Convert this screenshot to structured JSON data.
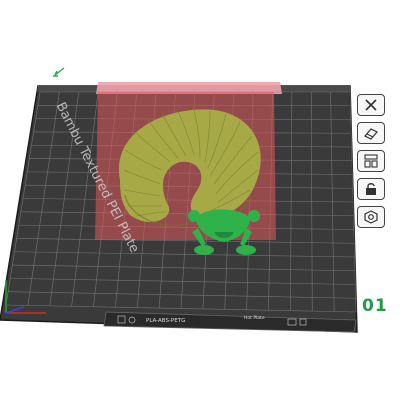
{
  "bed": {
    "label": "Bambu Textured PEI Plate",
    "plate_number": "01",
    "filament_info": "PLA-ABS-PETG",
    "tag_label": "Hot Plate"
  },
  "toolbar": {
    "items": [
      {
        "name": "close-tool-button",
        "icon": "close-icon"
      },
      {
        "name": "orient-tool-button",
        "icon": "orient-icon"
      },
      {
        "name": "arrange-tool-button",
        "icon": "arrange-icon"
      },
      {
        "name": "lock-tool-button",
        "icon": "lock-icon"
      },
      {
        "name": "settings-tool-button",
        "icon": "gear-icon"
      }
    ]
  },
  "colors": {
    "bed": "#3b3b3b",
    "grid": "#8a8a8a",
    "exclusion_zone": "#d94a4a",
    "model": "#9ea63e",
    "selected_model": "#27b043",
    "accent": "#1f9d45"
  }
}
